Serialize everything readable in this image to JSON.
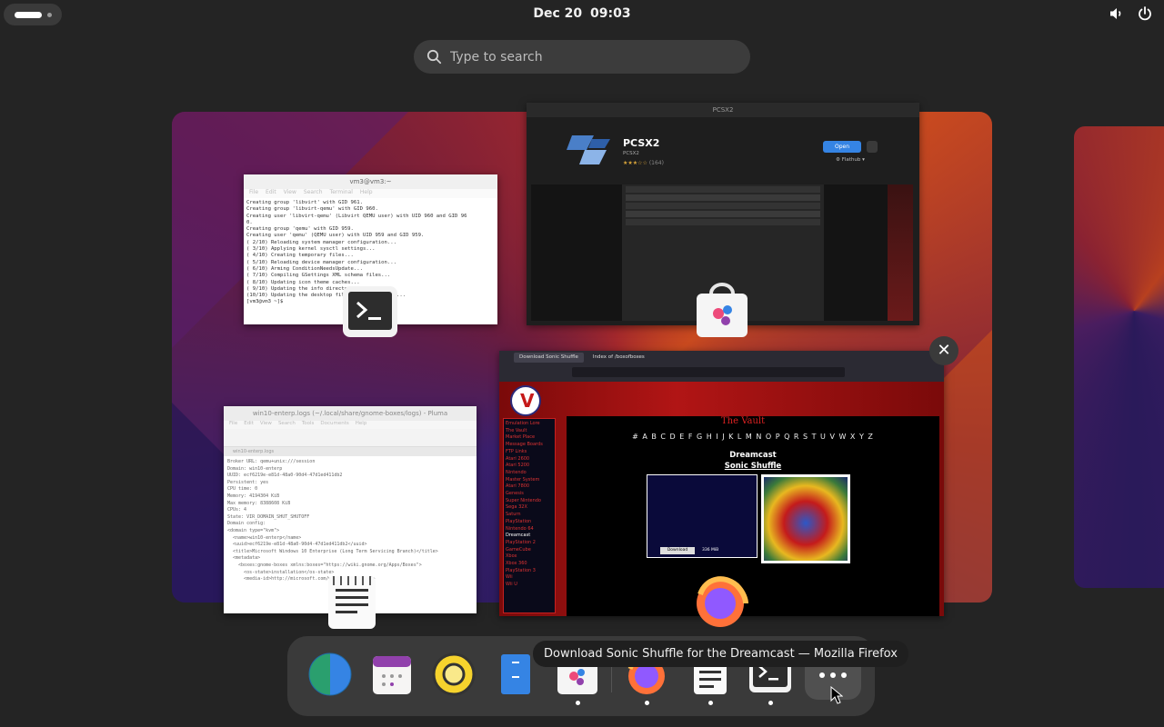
{
  "topbar": {
    "date": "Dec 20",
    "time": "09:03",
    "icons": [
      "volume-icon",
      "power-icon"
    ]
  },
  "search": {
    "placeholder": "Type to search"
  },
  "windows": {
    "terminal": {
      "title": "vm3@vm3:~",
      "menu": [
        "File",
        "Edit",
        "View",
        "Search",
        "Terminal",
        "Help"
      ],
      "lines": [
        "Creating group 'libvirt' with GID 961.",
        "Creating group 'libvirt-qemu' with GID 960.",
        "Creating user 'libvirt-qemu' (Libvirt QEMU user) with UID 960 and GID 96",
        "0.",
        "Creating group 'qemu' with GID 959.",
        "Creating user 'qemu' (QEMU user) with UID 959 and GID 959.",
        "( 2/10) Reloading system manager configuration...",
        "( 3/10) Applying kernel sysctl settings...",
        "( 4/10) Creating temporary files...",
        "( 5/10) Reloading device manager configuration...",
        "( 6/10) Arming ConditionNeedsUpdate...",
        "( 7/10) Compiling GSettings XML schema files...",
        "( 8/10) Updating icon theme caches...",
        "( 9/10) Updating the info directory file...",
        "(10/10) Updating the desktop file MIME type cache...",
        "[vm3@vm3 ~]$ "
      ]
    },
    "software": {
      "title": "PCSX2",
      "app_name": "PCSX2",
      "developer": "PCSX2",
      "rating_count": "(164)",
      "open_label": "Open",
      "source": "Flathub"
    },
    "firefox": {
      "tabs": [
        "Download Sonic Shuffle",
        "Index of /boxofboxes"
      ],
      "site_title": "The Vault",
      "letters": "# A B C D E F G H I J K L M N O P Q R S T U V W X Y Z",
      "platform": "Dreamcast",
      "game": "Sonic Shuffle",
      "sidebar": [
        "Emulation Lore",
        "The Vault",
        "Market Place",
        "Message Boards",
        "FTP Links",
        "",
        "Atari 2600",
        "Atari 5200",
        "Nintendo",
        "Master System",
        "Atari 7800",
        "Genesis",
        "Super Nintendo",
        "Sega 32X",
        "Saturn",
        "PlayStation",
        "Nintendo 64",
        "Dreamcast",
        "PlayStation 2",
        "GameCube",
        "Xbox",
        "Xbox 360",
        "PlayStation 3",
        "Wii",
        "Wii U"
      ],
      "download_label": "Download",
      "size": "336 MiB"
    },
    "pluma": {
      "title": "win10-enterp.logs (~/.local/share/gnome-boxes/logs) - Pluma",
      "menu": [
        "File",
        "Edit",
        "View",
        "Search",
        "Tools",
        "Documents",
        "Help"
      ],
      "tab": "win10-enterp.logs",
      "lines": [
        "Broker URL: qemu+unix:///session",
        "Domain: win10-enterp",
        "UUID: ecf6219e-e81d-48a0-90d4-47d1ed411db2",
        "Persistent: yes",
        "CPU time: 0",
        "Memory: 4194304 KiB",
        "Max memory: 8388608 KiB",
        "CPUs: 4",
        "State: VIR_DOMAIN_SHUT_SHUTOFF",
        "",
        "Domain config:",
        "",
        "<domain type=\"kvm\">",
        "  <name>win10-enterp</name>",
        "  <uuid>ecf6219e-e81d-48a0-90d4-47d1ed411db2</uuid>",
        "  <title>Microsoft Windows 10 Enterprise (Long Term Servicing Branch)</title>",
        "  <metadata>",
        "    <boxes:gnome-boxes xmlns:boxes=\"https://wiki.gnome.org/Apps/Boxes\">",
        "      <os-state>installation</os-state>",
        "      <media-id>http://microsoft.com/win/10</media-id>"
      ]
    }
  },
  "tooltip": "Download Sonic Shuffle for the Dreamcast — Mozilla Firefox",
  "dash": {
    "apps": [
      "browser-globe-icon",
      "calendar-icon",
      "rhythmbox-icon",
      "files-icon",
      "software-icon",
      "firefox-icon",
      "text-editor-icon",
      "terminal-icon"
    ],
    "show_apps": "show-apps-icon"
  }
}
